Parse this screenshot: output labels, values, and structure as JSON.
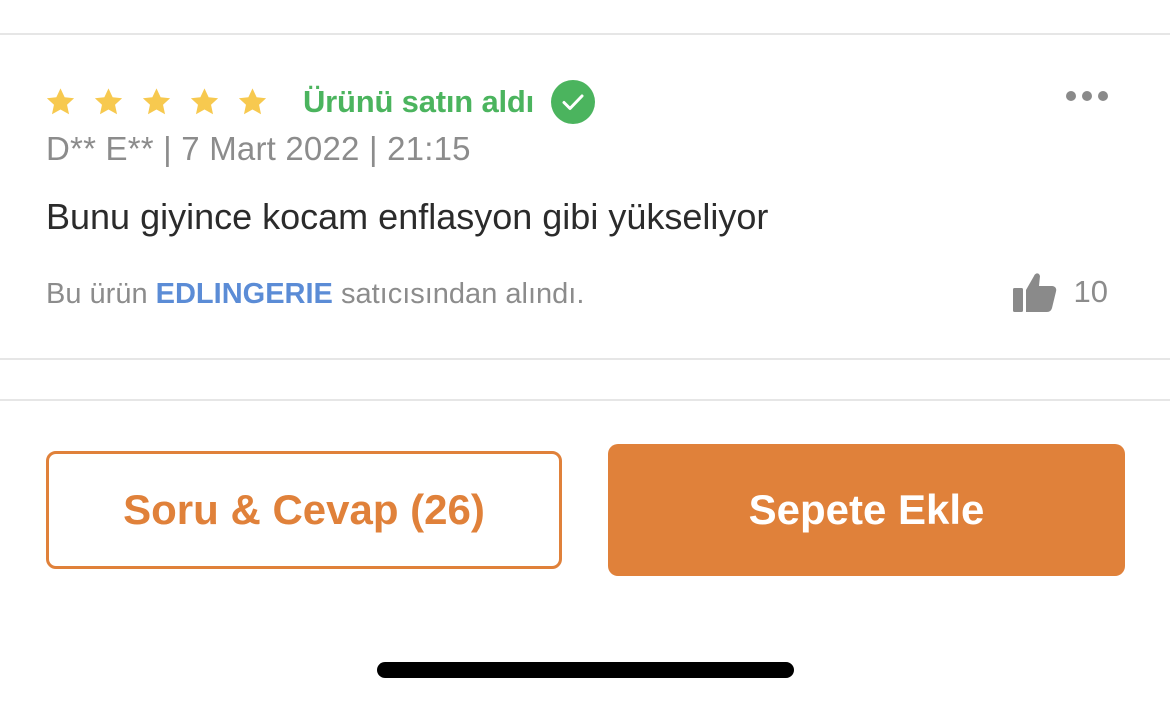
{
  "review": {
    "rating": 5,
    "max_rating": 5,
    "verified_label": "Ürünü satın aldı",
    "meta": "D** E** | 7 Mart 2022 | 21:15",
    "text": "Bunu giyince kocam enflasyon gibi yükseliyor",
    "seller_prefix": "Bu ürün ",
    "seller_name": "EDLINGERIE",
    "seller_suffix": " satıcısından alındı.",
    "likes": "10"
  },
  "actions": {
    "qa_label": "Soru & Cevap (26)",
    "cart_label": "Sepete Ekle"
  },
  "colors": {
    "star": "#f7c94f",
    "verified": "#4bb45e",
    "accent": "#e0813a",
    "seller_link": "#5b8cd6",
    "muted_text": "#8c8c8c"
  },
  "icons": {
    "star": "star-icon",
    "verified": "check-circle-icon",
    "more": "more-dots-icon",
    "like": "thumbs-up-icon"
  }
}
